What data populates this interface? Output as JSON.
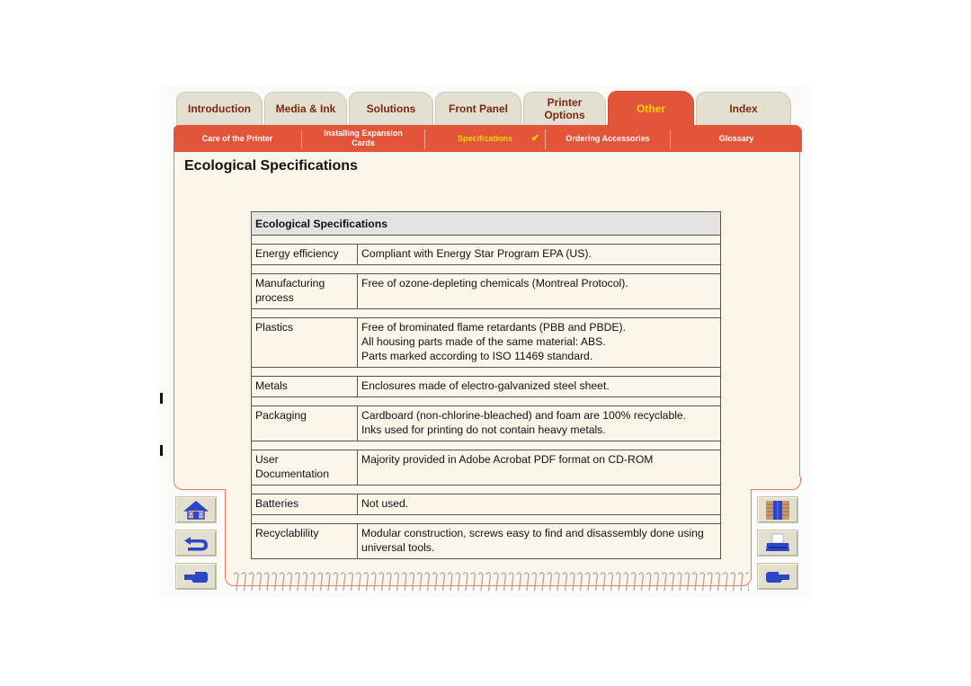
{
  "tabs": [
    {
      "label": "Introduction",
      "active": false
    },
    {
      "label": "Media & Ink",
      "active": false
    },
    {
      "label": "Solutions",
      "active": false
    },
    {
      "label": "Front Panel",
      "active": false
    },
    {
      "label": "Printer Options",
      "active": false
    },
    {
      "label": "Other",
      "active": true
    },
    {
      "label": "Index",
      "active": false
    }
  ],
  "subnav": [
    {
      "label": "Care of the Printer",
      "active": false
    },
    {
      "label": "Installing Expansion Cards",
      "active": false
    },
    {
      "label": "Specifications",
      "active": true,
      "check": "✔"
    },
    {
      "label": "Ordering Accessories",
      "active": false
    },
    {
      "label": "Glossary",
      "active": false
    }
  ],
  "page": {
    "title": "Ecological Specifications"
  },
  "table": {
    "header": "Ecological Specifications",
    "rows": [
      {
        "key": "Energy efficiency",
        "value": [
          "Compliant with Energy Star Program EPA (US)."
        ]
      },
      {
        "key": "Manufacturing process",
        "value": [
          "Free of ozone-depleting chemicals (Montreal Protocol)."
        ]
      },
      {
        "key": "Plastics",
        "value": [
          "Free of brominated flame retardants (PBB and PBDE).",
          "All housing parts made of the same material: ABS.",
          "Parts marked according to ISO 11469 standard."
        ]
      },
      {
        "key": "Metals",
        "value": [
          "Enclosures made of electro-galvanized steel sheet."
        ]
      },
      {
        "key": "Packaging",
        "value": [
          "Cardboard (non-chlorine-bleached) and foam are 100% recyclable.",
          "Inks used for printing do not contain heavy metals."
        ]
      },
      {
        "key": "User Documentation",
        "value": [
          "Majority provided in Adobe Acrobat PDF format on CD-ROM"
        ]
      },
      {
        "key": "Batteries",
        "value": [
          "Not used."
        ]
      },
      {
        "key": "Recyclablility",
        "value": [
          "Modular construction, screws easy to find and disassembly done using universal tools."
        ]
      }
    ]
  },
  "nav_buttons": {
    "left": [
      {
        "icon": "home-icon"
      },
      {
        "icon": "back-arrow-icon"
      },
      {
        "icon": "previous-page-hand-icon"
      }
    ],
    "right": [
      {
        "icon": "exit-door-icon"
      },
      {
        "icon": "printer-icon"
      },
      {
        "icon": "next-page-hand-icon"
      }
    ]
  },
  "colors": {
    "accent": "#e3553a",
    "active_text": "#f7d400",
    "tab_text": "#7a2a0e",
    "tab_bg": "#e3dfd1",
    "panel_bg": "#fcf5ea",
    "icon_blue": "#2d46c8"
  }
}
